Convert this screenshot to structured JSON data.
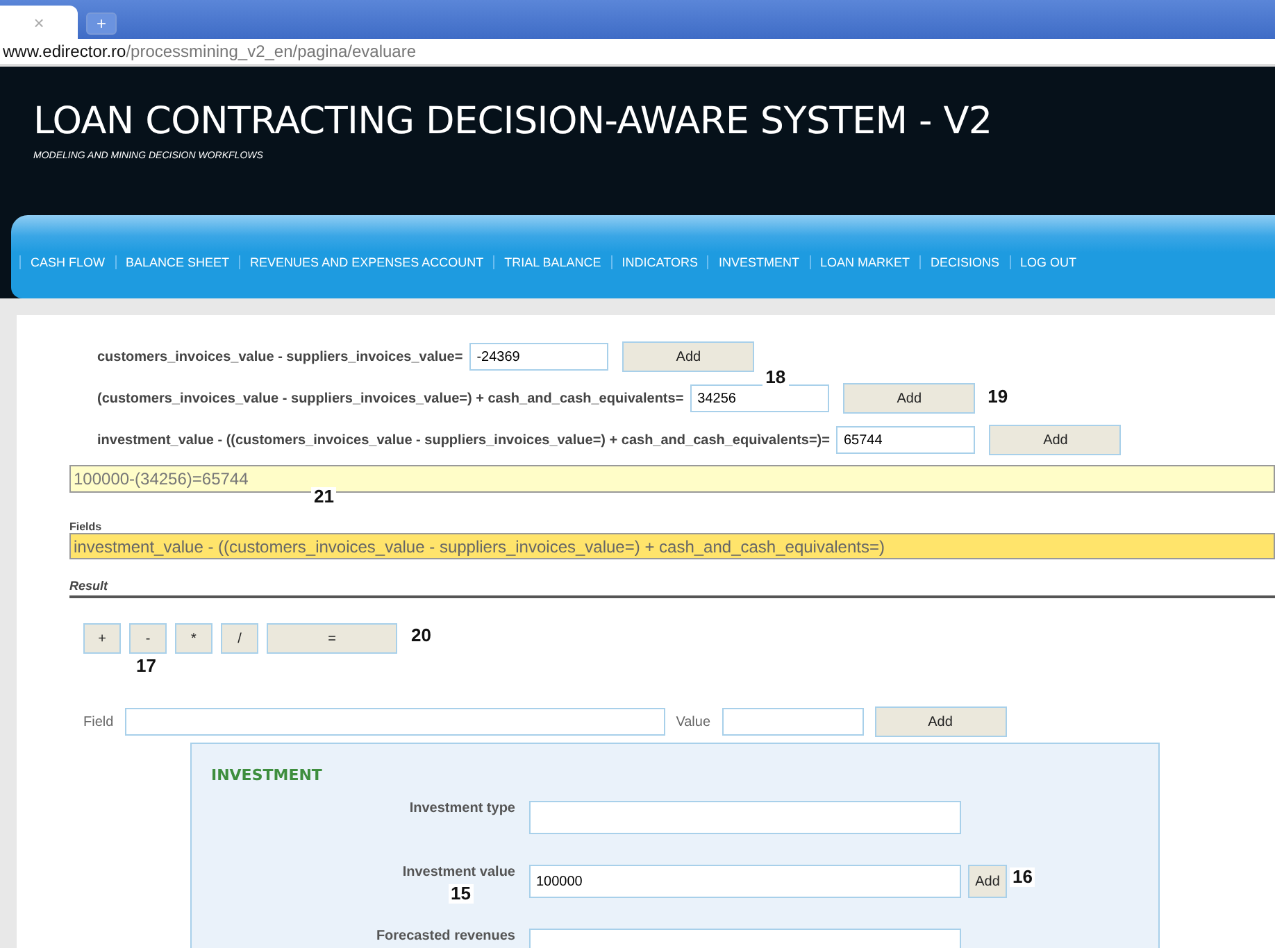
{
  "browser": {
    "tab_close": "×",
    "new_tab": "+",
    "url_host": "www.edirector.ro",
    "url_path": "/processmining_v2_en/pagina/evaluare"
  },
  "header": {
    "title": "LOAN CONTRACTING DECISION-AWARE SYSTEM - V2",
    "subtitle": "MODELING AND MINING DECISION WORKFLOWS"
  },
  "nav": [
    "CASH FLOW",
    "BALANCE SHEET",
    "REVENUES AND EXPENSES ACCOUNT",
    "TRIAL BALANCE",
    "INDICATORS",
    "INVESTMENT",
    "LOAN MARKET",
    "DECISIONS",
    "LOG OUT"
  ],
  "formula_rows": [
    {
      "label": "customers_invoices_value - suppliers_invoices_value=",
      "value": "-24369",
      "button": "Add"
    },
    {
      "label": "(customers_invoices_value - suppliers_invoices_value=) + cash_and_cash_equivalents=",
      "value": "34256",
      "button": "Add",
      "input_note": "18",
      "button_note": "19"
    },
    {
      "label": "investment_value - ((customers_invoices_value - suppliers_invoices_value=) + cash_and_cash_equivalents=)=",
      "value": "65744",
      "button": "Add"
    }
  ],
  "expression": {
    "value": "100000-(34256)=65744",
    "note": "21"
  },
  "fields": {
    "label": "Fields",
    "value": "investment_value - ((customers_invoices_value - suppliers_invoices_value=) + cash_and_cash_equivalents=)"
  },
  "result": {
    "label": "Result"
  },
  "operators": [
    {
      "label": "+",
      "kind": "small"
    },
    {
      "label": "-",
      "kind": "small",
      "note": "17"
    },
    {
      "label": "*",
      "kind": "small"
    },
    {
      "label": "/",
      "kind": "small"
    },
    {
      "label": "=",
      "kind": "wide",
      "note": "20"
    }
  ],
  "add_field": {
    "field_label": "Field",
    "value_label": "Value",
    "button": "Add"
  },
  "investment": {
    "title": "INVESTMENT",
    "rows": [
      {
        "label": "Investment type"
      },
      {
        "label": "Investment value",
        "value": "100000",
        "label_note": "15",
        "button": "Add",
        "button_note": "16"
      },
      {
        "label": "Forecasted revenues"
      }
    ]
  }
}
